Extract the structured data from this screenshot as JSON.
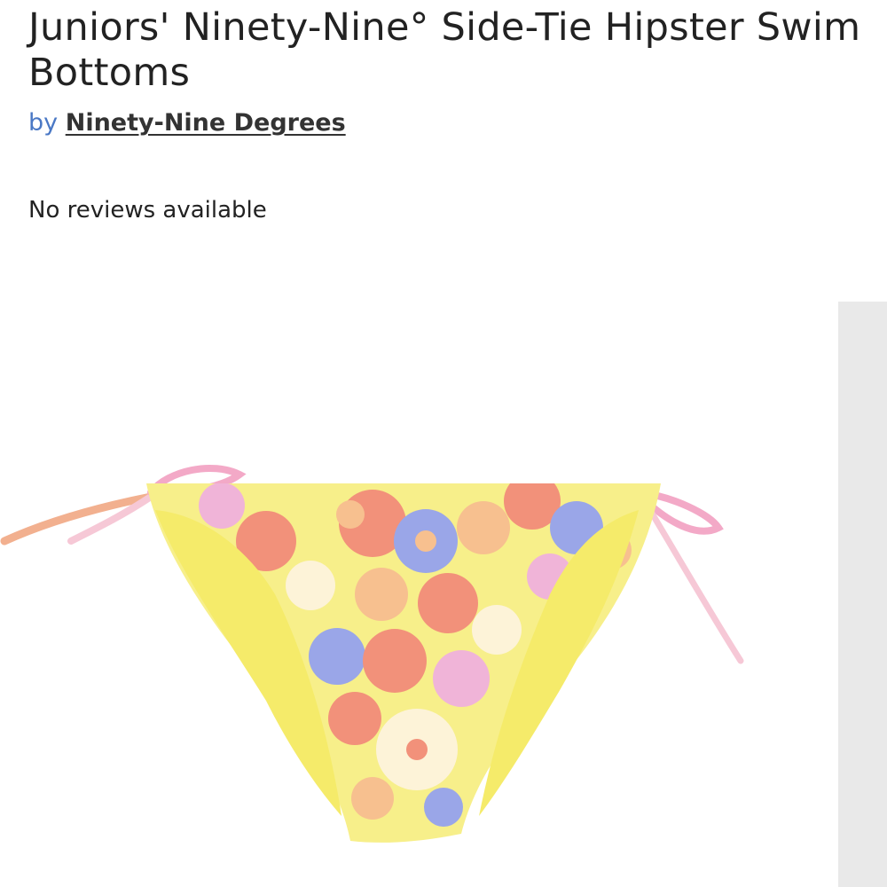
{
  "product": {
    "title": "Juniors' Ninety-Nine° Side-Tie Hipster Swim Bottoms",
    "by_label": "by",
    "brand": "Ninety-Nine Degrees",
    "reviews_text": "No reviews available"
  },
  "image": {
    "subject": "floral side-tie bikini bottoms",
    "colors": {
      "base": "#f7ef8a",
      "lining": "#f5eb6a",
      "coral": "#f2917a",
      "peach": "#f7c08f",
      "lavender": "#9aa6e8",
      "pink": "#f0b4d8",
      "cream": "#fdf3d8"
    }
  }
}
